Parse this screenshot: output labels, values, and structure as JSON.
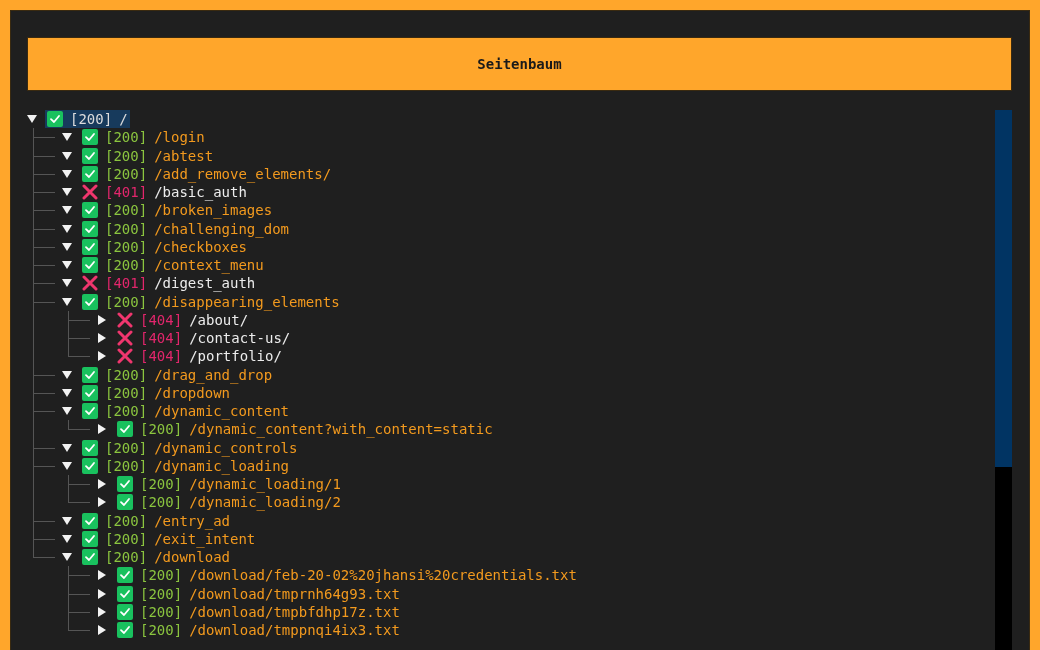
{
  "header": {
    "title": "Seitenbaum"
  },
  "tree": [
    {
      "status": "[200]",
      "path": "/",
      "ok": true,
      "expanded": true,
      "selected": true,
      "children": [
        {
          "status": "[200]",
          "path": "/login",
          "ok": true,
          "expanded": true,
          "selected": false
        },
        {
          "status": "[200]",
          "path": "/abtest",
          "ok": true,
          "expanded": true,
          "selected": false
        },
        {
          "status": "[200]",
          "path": "/add_remove_elements/",
          "ok": true,
          "expanded": true,
          "selected": false
        },
        {
          "status": "[401]",
          "path": "/basic_auth",
          "ok": false,
          "expanded": true,
          "selected": false
        },
        {
          "status": "[200]",
          "path": "/broken_images",
          "ok": true,
          "expanded": true,
          "selected": false
        },
        {
          "status": "[200]",
          "path": "/challenging_dom",
          "ok": true,
          "expanded": true,
          "selected": false
        },
        {
          "status": "[200]",
          "path": "/checkboxes",
          "ok": true,
          "expanded": true,
          "selected": false
        },
        {
          "status": "[200]",
          "path": "/context_menu",
          "ok": true,
          "expanded": true,
          "selected": false
        },
        {
          "status": "[401]",
          "path": "/digest_auth",
          "ok": false,
          "expanded": true,
          "selected": false
        },
        {
          "status": "[200]",
          "path": "/disappearing_elements",
          "ok": true,
          "expanded": true,
          "selected": false,
          "children": [
            {
              "status": "[404]",
              "path": "/about/",
              "ok": false,
              "expanded": false,
              "selected": false
            },
            {
              "status": "[404]",
              "path": "/contact-us/",
              "ok": false,
              "expanded": false,
              "selected": false
            },
            {
              "status": "[404]",
              "path": "/portfolio/",
              "ok": false,
              "expanded": false,
              "selected": false
            }
          ]
        },
        {
          "status": "[200]",
          "path": "/drag_and_drop",
          "ok": true,
          "expanded": true,
          "selected": false
        },
        {
          "status": "[200]",
          "path": "/dropdown",
          "ok": true,
          "expanded": true,
          "selected": false
        },
        {
          "status": "[200]",
          "path": "/dynamic_content",
          "ok": true,
          "expanded": true,
          "selected": false,
          "children": [
            {
              "status": "[200]",
              "path": "/dynamic_content?with_content=static",
              "ok": true,
              "expanded": false,
              "selected": false
            }
          ]
        },
        {
          "status": "[200]",
          "path": "/dynamic_controls",
          "ok": true,
          "expanded": true,
          "selected": false
        },
        {
          "status": "[200]",
          "path": "/dynamic_loading",
          "ok": true,
          "expanded": true,
          "selected": false,
          "children": [
            {
              "status": "[200]",
              "path": "/dynamic_loading/1",
              "ok": true,
              "expanded": false,
              "selected": false
            },
            {
              "status": "[200]",
              "path": "/dynamic_loading/2",
              "ok": true,
              "expanded": false,
              "selected": false
            }
          ]
        },
        {
          "status": "[200]",
          "path": "/entry_ad",
          "ok": true,
          "expanded": true,
          "selected": false
        },
        {
          "status": "[200]",
          "path": "/exit_intent",
          "ok": true,
          "expanded": true,
          "selected": false
        },
        {
          "status": "[200]",
          "path": "/download",
          "ok": true,
          "expanded": true,
          "selected": false,
          "children": [
            {
              "status": "[200]",
              "path": "/download/feb-20-02%20jhansi%20credentials.txt",
              "ok": true,
              "expanded": false,
              "selected": false
            },
            {
              "status": "[200]",
              "path": "/download/tmprnh64g93.txt",
              "ok": true,
              "expanded": false,
              "selected": false
            },
            {
              "status": "[200]",
              "path": "/download/tmpbfdhp17z.txt",
              "ok": true,
              "expanded": false,
              "selected": false
            },
            {
              "status": "[200]",
              "path": "/download/tmppnqi4ix3.txt",
              "ok": true,
              "expanded": false,
              "selected": false
            }
          ]
        }
      ]
    }
  ]
}
